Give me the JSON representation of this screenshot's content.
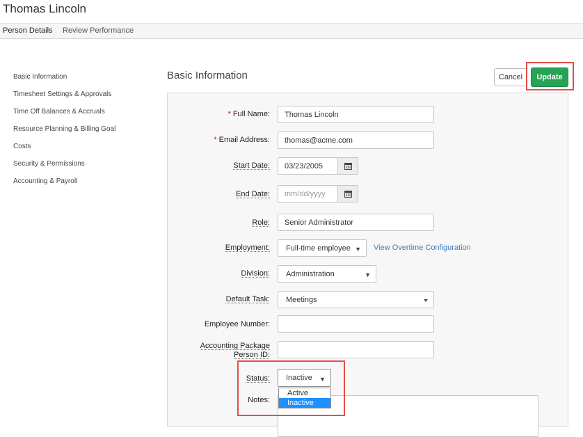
{
  "page": {
    "title": "Thomas Lincoln"
  },
  "tabs": [
    {
      "label": "Person Details",
      "active": true
    },
    {
      "label": "Review Performance",
      "active": false
    }
  ],
  "sidebar": {
    "items": [
      {
        "label": "Basic Information"
      },
      {
        "label": "Timesheet Settings & Approvals"
      },
      {
        "label": "Time Off Balances & Accruals"
      },
      {
        "label": "Resource Planning & Billing Goal"
      },
      {
        "label": "Costs"
      },
      {
        "label": "Security & Permissions"
      },
      {
        "label": "Accounting & Payroll"
      }
    ]
  },
  "section": {
    "title": "Basic Information"
  },
  "actions": {
    "cancel_label": "Cancel",
    "update_label": "Update"
  },
  "form": {
    "full_name": {
      "label": "Full Name:",
      "value": "Thomas Lincoln"
    },
    "email": {
      "label": "Email Address:",
      "value": "thomas@acme.com"
    },
    "start_date": {
      "label": "Start Date:",
      "value": "03/23/2005"
    },
    "end_date": {
      "label": "End Date:",
      "placeholder": "mm/dd/yyyy"
    },
    "role": {
      "label": "Role:",
      "value": "Senior Administrator"
    },
    "employment": {
      "label": "Employment:",
      "value": "Full-time employee",
      "link": "View Overtime Configuration"
    },
    "division": {
      "label": "Division:",
      "value": "Administration"
    },
    "default_task": {
      "label": "Default Task:",
      "value": "Meetings"
    },
    "employee_number": {
      "label": "Employee Number:",
      "value": ""
    },
    "accounting_id": {
      "label_line1": "Accounting Package",
      "label_line2": "Person ID:",
      "value": ""
    },
    "status": {
      "label": "Status:",
      "value": "Inactive",
      "options": [
        "Active",
        "Inactive"
      ],
      "selected": "Inactive"
    },
    "notes": {
      "label": "Notes:"
    }
  },
  "icons": {
    "calendar": "calendar-icon",
    "caret": "caret-down-icon"
  },
  "colors": {
    "accent": "#27a356",
    "link": "#3d7bb8",
    "highlight": "#e74c4c",
    "selected_option": "#1e90ff",
    "required": "#d0021b"
  }
}
